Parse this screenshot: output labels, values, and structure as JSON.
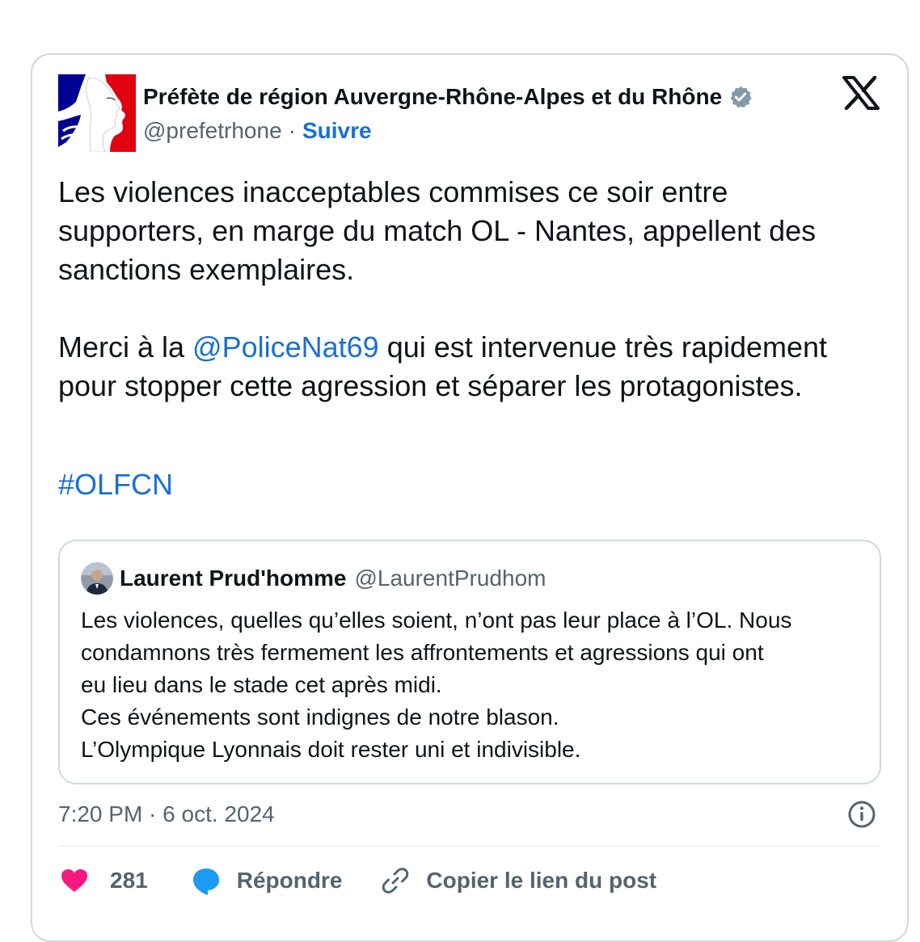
{
  "account": {
    "name": "Préfète de région Auvergne-Rhône-Alpes et du Rhône",
    "handle": "@prefetrhone",
    "separator": "·",
    "follow_label": "Suivre"
  },
  "tweet": {
    "paragraph1": "Les violences inacceptables commises ce soir entre supporters, en marge du match OL - Nantes, appellent des sanctions exemplaires.",
    "p2_before": "Merci à la ",
    "p2_mention": "@PoliceNat69",
    "p2_after": " qui est intervenue très rapidement pour stopper cette agression et séparer les protagonistes.",
    "hashtag": "#OLFCN"
  },
  "quoted": {
    "name": "Laurent Prud'homme",
    "handle": "@LaurentPrudhom",
    "lines": [
      "Les violences, quelles qu’elles soient, n’ont pas leur place à l’OL. Nous",
      "condamnons très fermement les affrontements et agressions qui ont",
      "eu lieu dans le stade cet après midi.",
      "Ces événements sont indignes de notre blason.",
      "L’Olympique Lyonnais doit rester uni et indivisible."
    ]
  },
  "meta": {
    "timestamp": "7:20 PM · 6 oct. 2024"
  },
  "actions": {
    "likes_count": "281",
    "reply_label": "Répondre",
    "copy_link_label": "Copier le lien du post"
  },
  "colors": {
    "link": "#1a6fd4",
    "heart": "#f91880",
    "reply": "#1d9bf0",
    "verified": "#829aab",
    "border": "#cfd9de",
    "muted": "#536471"
  },
  "icons": [
    "marianne-logo-icon",
    "verified-badge-icon",
    "x-logo-icon",
    "info-icon",
    "heart-icon",
    "reply-bubble-icon",
    "link-icon"
  ]
}
